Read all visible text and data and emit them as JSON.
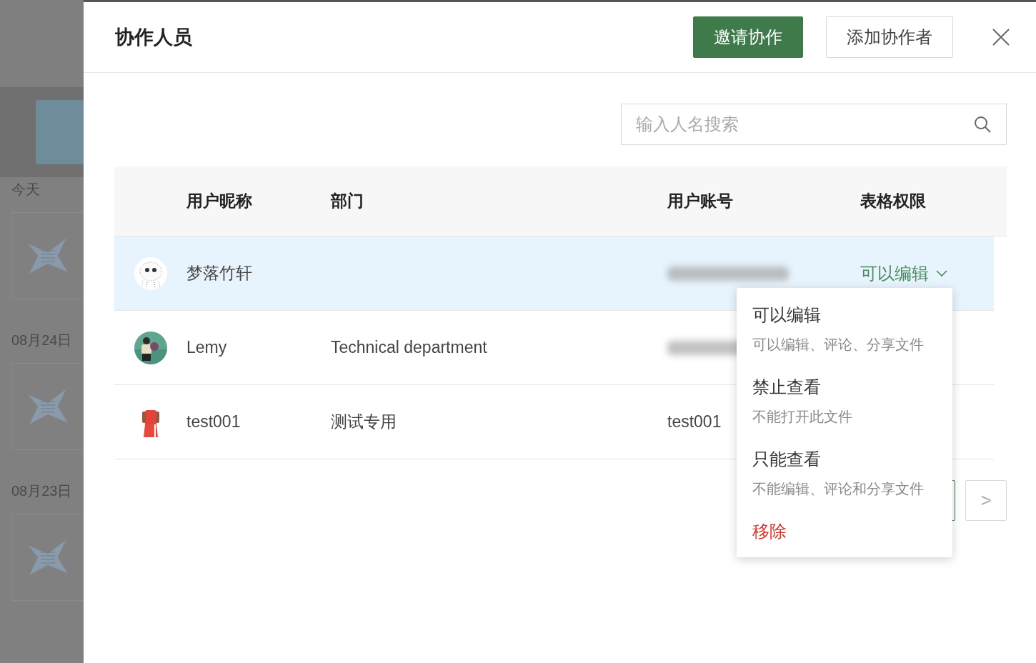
{
  "background": {
    "sections": [
      {
        "label": "今天"
      },
      {
        "label": "08月24日"
      },
      {
        "label": "08月23日"
      }
    ]
  },
  "drawer": {
    "title": "协作人员",
    "buttons": [
      {
        "label": "邀请协作",
        "kind": "primary"
      },
      {
        "label": "添加协作者",
        "kind": "default"
      }
    ],
    "search": {
      "placeholder": "输入人名搜索"
    },
    "table": {
      "columns": [
        "用户昵称",
        "部门",
        "用户账号",
        "表格权限"
      ],
      "rows": [
        {
          "name": "梦落竹轩",
          "department": "",
          "account_blurred": true,
          "account": "",
          "permission": "可以编辑",
          "selected": true
        },
        {
          "name": "Lemy",
          "department": "Technical department",
          "account_blurred": true,
          "account": "",
          "permission": "",
          "selected": false
        },
        {
          "name": "test001",
          "department": "测试专用",
          "account_blurred": false,
          "account": "test001",
          "permission": "",
          "selected": false
        }
      ]
    },
    "permission_menu": {
      "items": [
        {
          "kind": "option",
          "label": "可以编辑",
          "description": "可以编辑、评论、分享文件"
        },
        {
          "kind": "option",
          "label": "禁止查看",
          "description": "不能打开此文件"
        },
        {
          "kind": "option",
          "label": "只能查看",
          "description": "不能编辑、评论和分享文件"
        },
        {
          "kind": "danger",
          "label": "移除"
        }
      ]
    },
    "pagination": {
      "next": ">"
    }
  }
}
